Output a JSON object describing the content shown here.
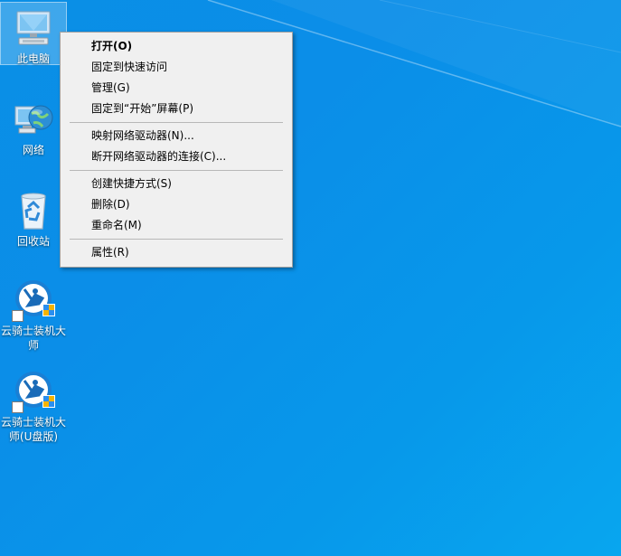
{
  "desktop": {
    "icons": [
      {
        "label": "此电脑",
        "icon": "this-pc-icon",
        "selected": true
      },
      {
        "label": "网络",
        "icon": "network-icon",
        "selected": false
      },
      {
        "label": "回收站",
        "icon": "recycle-bin-icon",
        "selected": false
      },
      {
        "label": "云骑士装机大师",
        "icon": "yunqishi-icon",
        "selected": false
      },
      {
        "label": "云骑士装机大师(U盘版)",
        "icon": "yunqishi-usb-icon",
        "selected": false
      }
    ]
  },
  "context_menu": {
    "items": [
      {
        "label": "打开(O)",
        "bold": true
      },
      {
        "label": "固定到快速访问"
      },
      {
        "label": "管理(G)"
      },
      {
        "label": "固定到“开始”屏幕(P)"
      },
      {
        "label": "映射网络驱动器(N)..."
      },
      {
        "label": "断开网络驱动器的连接(C)..."
      },
      {
        "label": "创建快捷方式(S)"
      },
      {
        "label": "删除(D)"
      },
      {
        "label": "重命名(M)"
      },
      {
        "label": "属性(R)"
      }
    ]
  },
  "colors": {
    "wallpaper": "#0b8ee8",
    "menu_background": "#f0f0f0",
    "menu_separator": "#b8b8b8"
  }
}
